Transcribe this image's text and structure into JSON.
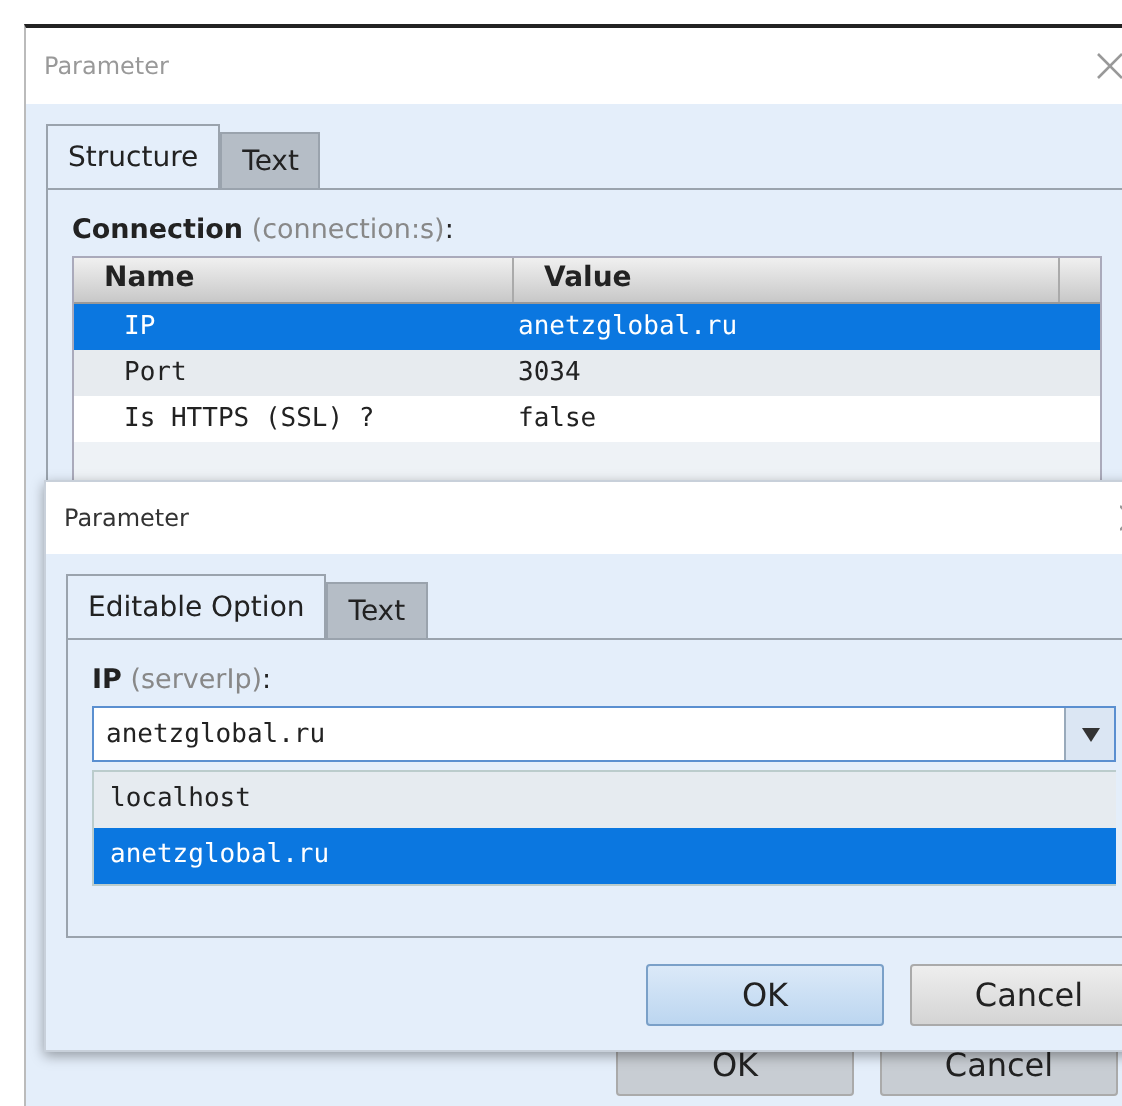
{
  "back_dialog": {
    "title": "Parameter",
    "tabs": [
      {
        "label": "Structure",
        "selected": true
      },
      {
        "label": "Text",
        "selected": false
      }
    ],
    "field": {
      "label": "Connection",
      "hint": "(connection:s)",
      "suffix": ":"
    },
    "table": {
      "columns": [
        "Name",
        "Value"
      ],
      "rows": [
        {
          "cells": [
            "IP",
            "anetzglobal.ru"
          ],
          "selected": true
        },
        {
          "cells": [
            "Port",
            "3034"
          ],
          "selected": false
        },
        {
          "cells": [
            "Is HTTPS (SSL) ?",
            "false"
          ],
          "selected": false
        }
      ]
    },
    "buttons": [
      {
        "label": "OK",
        "default": false
      },
      {
        "label": "Cancel",
        "default": false
      }
    ]
  },
  "front_dialog": {
    "title": "Parameter",
    "tabs": [
      {
        "label": "Editable Option",
        "selected": true
      },
      {
        "label": "Text",
        "selected": false
      }
    ],
    "field": {
      "label": "IP",
      "hint": "(serverIp)",
      "suffix": ":"
    },
    "combo": {
      "value": "anetzglobal.ru",
      "expanded": true,
      "options": [
        {
          "label": "localhost",
          "selected": false
        },
        {
          "label": "anetzglobal.ru",
          "selected": true
        }
      ]
    },
    "buttons": [
      {
        "label": "OK",
        "default": true
      },
      {
        "label": "Cancel",
        "default": false
      }
    ]
  }
}
